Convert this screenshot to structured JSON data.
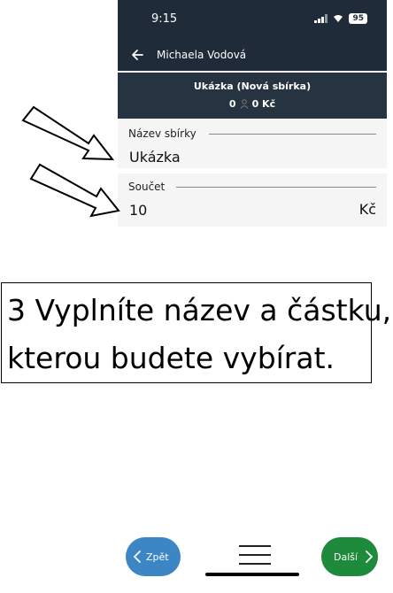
{
  "status_bar": {
    "time": "9:15",
    "battery": "95"
  },
  "app_bar": {
    "title": "Michaela Vodová"
  },
  "summary": {
    "title": "Ukázka (Nová sbírka)",
    "count": "0",
    "amount": "0 Kč"
  },
  "form": {
    "name_label": "Název sbírky",
    "name_value": "Ukázka",
    "sum_label": "Součet",
    "sum_value": "10",
    "sum_unit": "Kč"
  },
  "caption": {
    "line1": "3 Vyplníte název a částku,",
    "line2": "kterou budete vybírat."
  },
  "nav": {
    "back_label": "Zpět",
    "next_label": "Další"
  },
  "colors": {
    "header": "#1f2b38",
    "back_button": "#3d86c6",
    "next_button": "#1d8a3c"
  }
}
